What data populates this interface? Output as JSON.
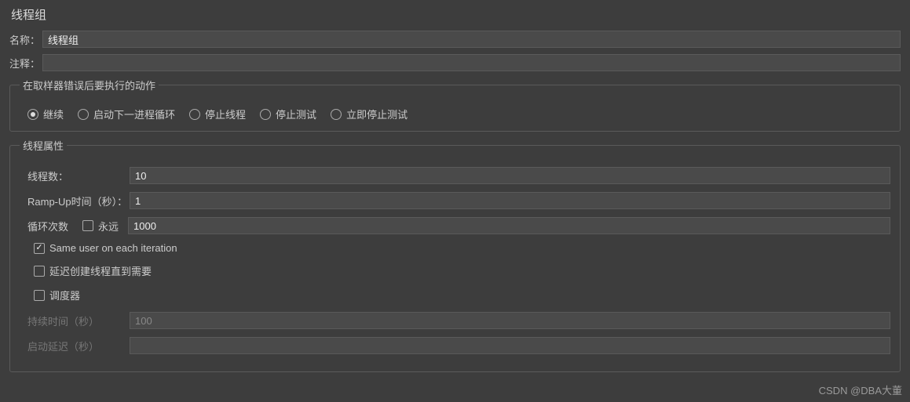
{
  "title": "线程组",
  "basic": {
    "nameLabel": "名称：",
    "nameValue": "线程组",
    "commentLabel": "注释：",
    "commentValue": ""
  },
  "errorSection": {
    "legend": "在取样器错误后要执行的动作",
    "options": {
      "continue": "继续",
      "startNextLoop": "启动下一进程循环",
      "stopThread": "停止线程",
      "stopTest": "停止测试",
      "stopTestNow": "立即停止测试"
    }
  },
  "threadProps": {
    "legend": "线程属性",
    "threadsLabel": "线程数：",
    "threadsValue": "10",
    "rampUpLabel": "Ramp-Up时间（秒）：",
    "rampUpValue": "1",
    "loopCountLabel": "循环次数",
    "foreverLabel": "永远",
    "loopCountValue": "1000",
    "sameUserLabel": "Same user on each iteration",
    "delayCreateLabel": "延迟创建线程直到需要",
    "schedulerLabel": "调度器",
    "durationLabel": "持续时间（秒）",
    "durationValue": "100",
    "startupDelayLabel": "启动延迟（秒）",
    "startupDelayValue": ""
  },
  "watermark": "CSDN @DBA大董"
}
